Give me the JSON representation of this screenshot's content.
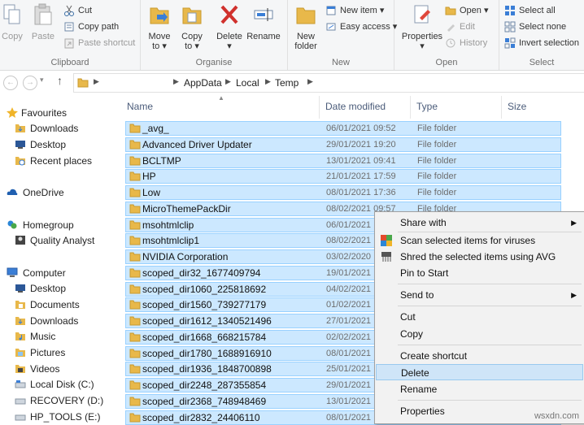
{
  "ribbon": {
    "clipboard": {
      "label": "Clipboard",
      "copy": "Copy",
      "paste": "Paste",
      "cut": "Cut",
      "copy_path": "Copy path",
      "paste_shortcut": "Paste shortcut"
    },
    "organise": {
      "label": "Organise",
      "move_to": "Move\nto ▾",
      "copy_to": "Copy\nto ▾",
      "delete": "Delete\n▾",
      "rename": "Rename"
    },
    "new": {
      "label": "New",
      "new_folder": "New\nfolder",
      "new_item": "New item ▾",
      "easy_access": "Easy access ▾"
    },
    "open": {
      "label": "Open",
      "properties": "Properties\n▾",
      "open": "Open ▾",
      "edit": "Edit",
      "history": "History"
    },
    "select": {
      "label": "Select",
      "select_all": "Select all",
      "select_none": "Select none",
      "invert_selection": "Invert selection"
    }
  },
  "address": {
    "back": "←",
    "forward": "→",
    "up": "↑",
    "crumbs": [
      "AppData",
      "Local",
      "Temp"
    ]
  },
  "nav": {
    "favourites": "Favourites",
    "downloads": "Downloads",
    "desktop": "Desktop",
    "recent_places": "Recent places",
    "onedrive": "OneDrive",
    "homegroup": "Homegroup",
    "quality_analyst": "Quality Analyst",
    "computer": "Computer",
    "pc_desktop": "Desktop",
    "documents": "Documents",
    "pc_downloads": "Downloads",
    "music": "Music",
    "pictures": "Pictures",
    "videos": "Videos",
    "local_disk": "Local Disk (C:)",
    "recovery": "RECOVERY (D:)",
    "hp_tools": "HP_TOOLS (E:)"
  },
  "columns": {
    "name": "Name",
    "date": "Date modified",
    "type": "Type",
    "size": "Size"
  },
  "files": [
    {
      "name": "_avg_",
      "date": "06/01/2021 09:52",
      "type": "File folder"
    },
    {
      "name": "Advanced Driver Updater",
      "date": "29/01/2021 19:20",
      "type": "File folder"
    },
    {
      "name": "BCLTMP",
      "date": "13/01/2021 09:41",
      "type": "File folder"
    },
    {
      "name": "HP",
      "date": "21/01/2021 17:59",
      "type": "File folder"
    },
    {
      "name": "Low",
      "date": "08/01/2021 17:36",
      "type": "File folder"
    },
    {
      "name": "MicroThemePackDir",
      "date": "08/02/2021 09:57",
      "type": "File folder"
    },
    {
      "name": "msohtmlclip",
      "date": "06/01/2021",
      "type": ""
    },
    {
      "name": "msohtmlclip1",
      "date": "08/02/2021",
      "type": ""
    },
    {
      "name": "NVIDIA Corporation",
      "date": "03/02/2020",
      "type": ""
    },
    {
      "name": "scoped_dir32_1677409794",
      "date": "19/01/2021",
      "type": ""
    },
    {
      "name": "scoped_dir1060_225818692",
      "date": "04/02/2021",
      "type": ""
    },
    {
      "name": "scoped_dir1560_739277179",
      "date": "01/02/2021",
      "type": ""
    },
    {
      "name": "scoped_dir1612_1340521496",
      "date": "27/01/2021",
      "type": ""
    },
    {
      "name": "scoped_dir1668_668215784",
      "date": "02/02/2021",
      "type": ""
    },
    {
      "name": "scoped_dir1780_1688916910",
      "date": "08/01/2021",
      "type": ""
    },
    {
      "name": "scoped_dir1936_1848700898",
      "date": "25/01/2021",
      "type": ""
    },
    {
      "name": "scoped_dir2248_287355854",
      "date": "29/01/2021",
      "type": ""
    },
    {
      "name": "scoped_dir2368_748948469",
      "date": "13/01/2021",
      "type": ""
    },
    {
      "name": "scoped_dir2832_24406110",
      "date": "08/01/2021",
      "type": ""
    }
  ],
  "context_menu": {
    "share_with": "Share with",
    "scan_viruses": "Scan selected items for viruses",
    "shred_avg": "Shred the selected items using AVG",
    "pin_to_start": "Pin to Start",
    "send_to": "Send to",
    "cut": "Cut",
    "copy": "Copy",
    "create_shortcut": "Create shortcut",
    "delete": "Delete",
    "rename": "Rename",
    "properties": "Properties",
    "submenu_arrow": "▶"
  },
  "watermark": "wsxdn.com",
  "colors": {
    "selection": "#cce8ff",
    "selection_border": "#99d1ff",
    "folder": "#e8b84a",
    "ribbon_bg": "#f5f6f7"
  }
}
